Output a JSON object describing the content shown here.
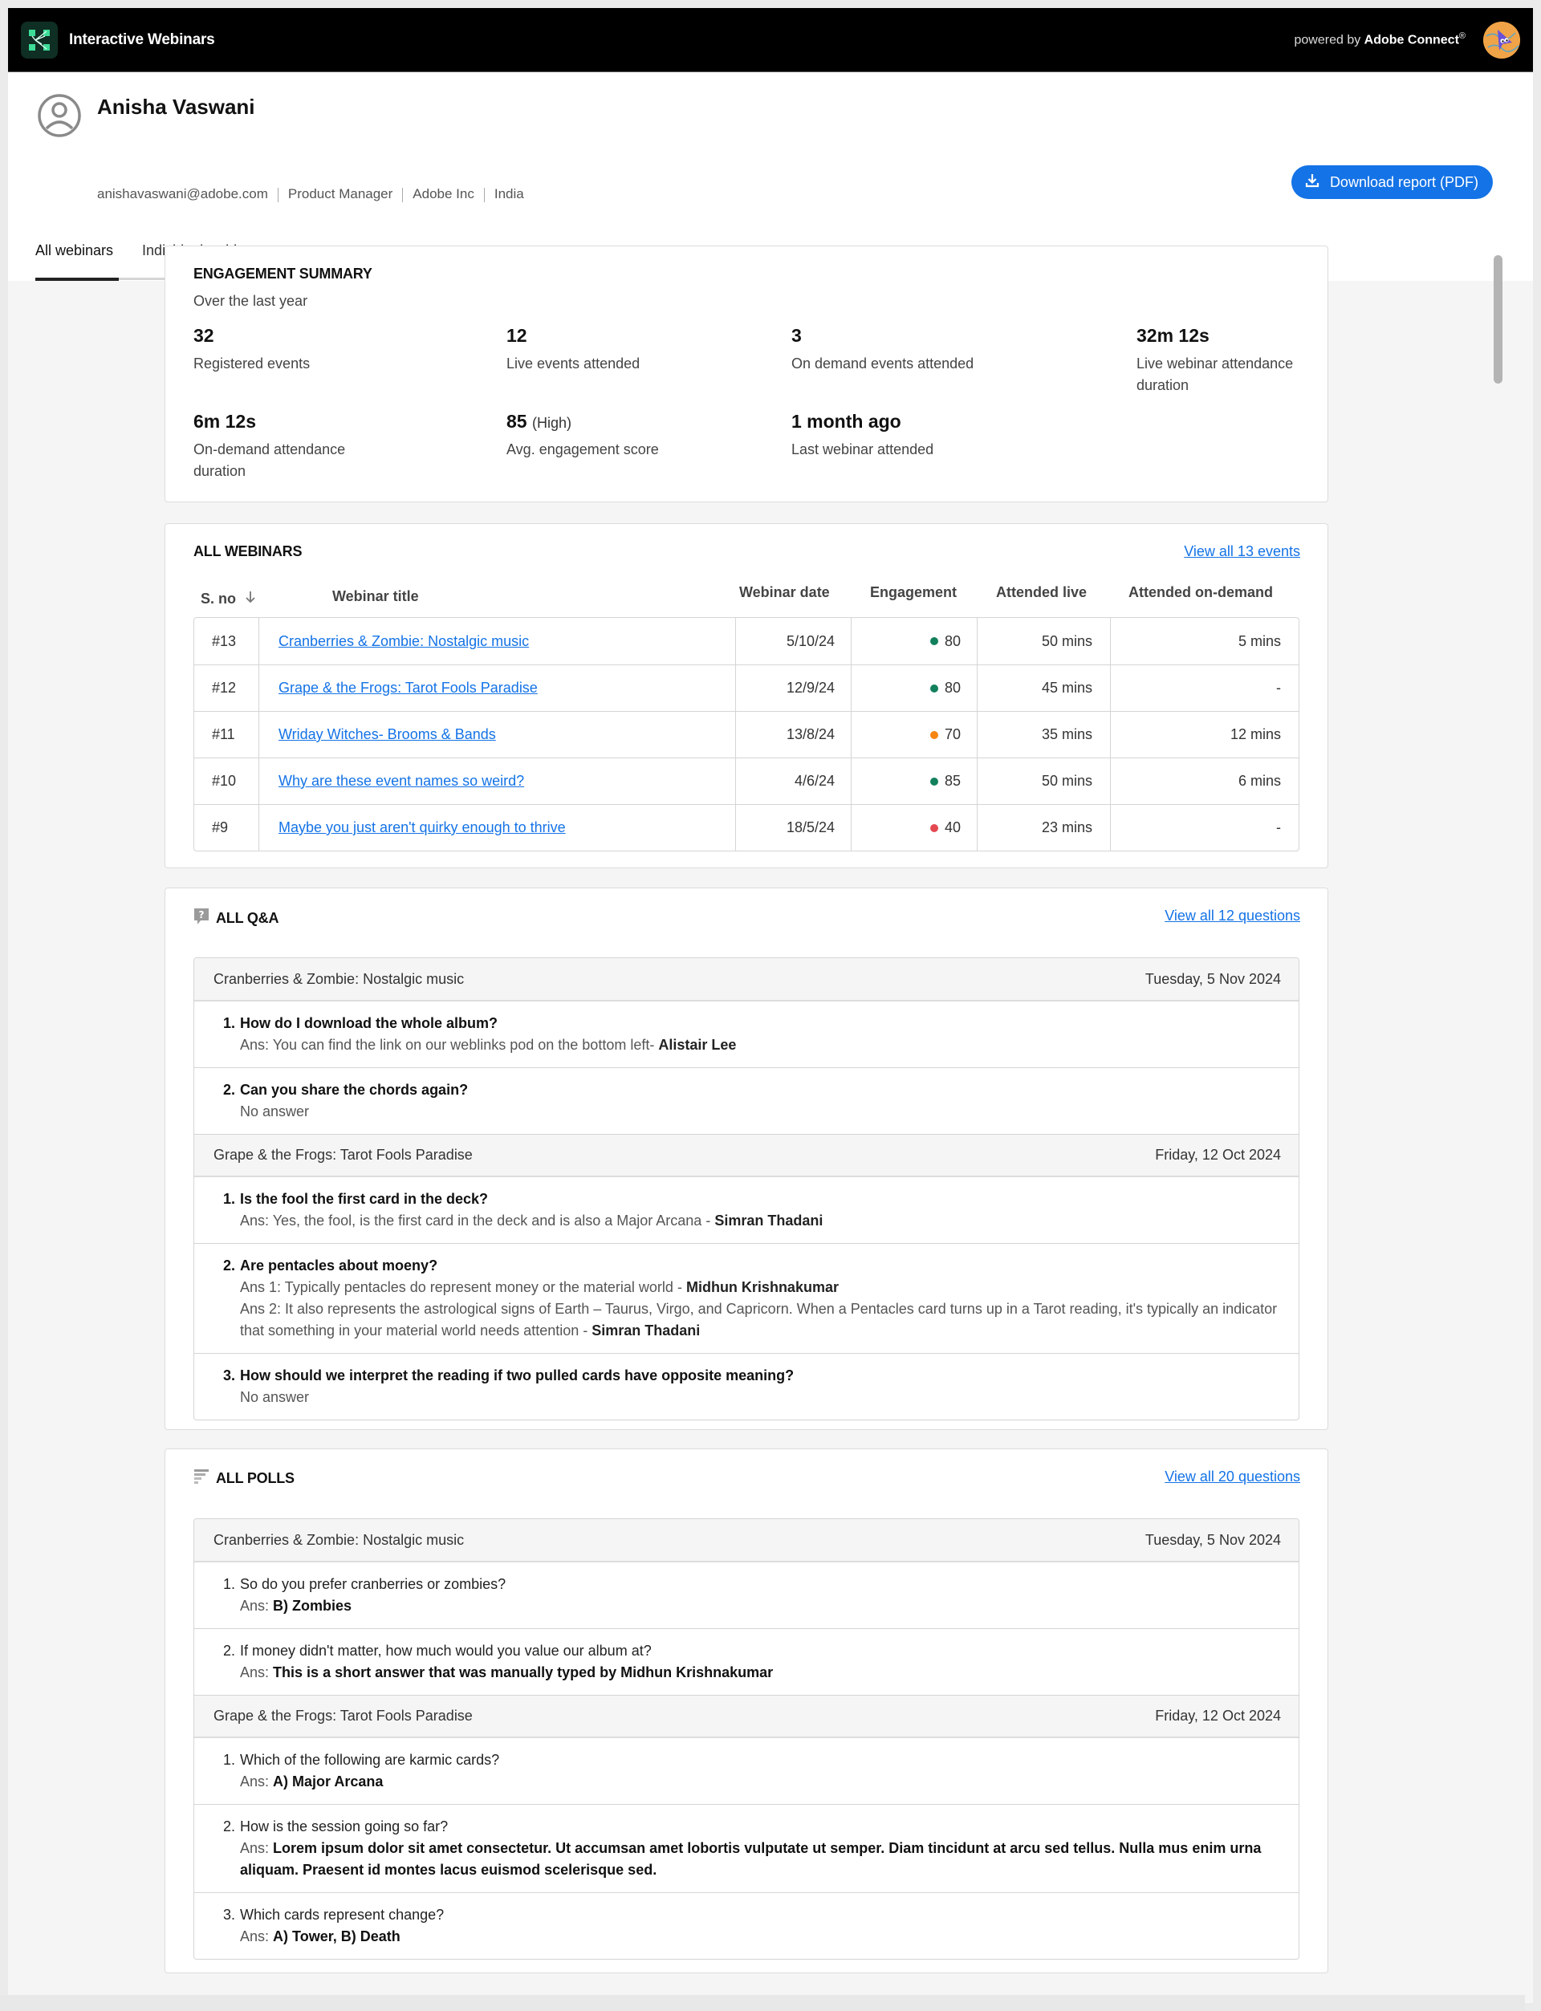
{
  "topbar": {
    "app_title": "Interactive Webinars",
    "powered_prefix": "powered by",
    "powered_brand": "Adobe Connect",
    "powered_mark": "®"
  },
  "profile": {
    "name": "Anisha Vaswani",
    "email": "anishavaswani@adobe.com",
    "role": "Product Manager",
    "company": "Adobe Inc",
    "country": "India",
    "download_label": "Download report (PDF)"
  },
  "tabs": [
    {
      "label": "All webinars",
      "active": true
    },
    {
      "label": "Individual webinar",
      "active": false
    }
  ],
  "summary": {
    "title": "ENGAGEMENT SUMMARY",
    "subtitle": "Over the last year",
    "stats": [
      {
        "value": "32",
        "suffix": "",
        "label": "Registered events"
      },
      {
        "value": "12",
        "suffix": "",
        "label": "Live events attended"
      },
      {
        "value": "3",
        "suffix": "",
        "label": "On demand events attended"
      },
      {
        "value": "32m 12s",
        "suffix": "",
        "label": "Live webinar attendance duration"
      },
      {
        "value": "6m 12s",
        "suffix": "",
        "label": "On-demand attendance duration"
      },
      {
        "value": "85",
        "suffix": "(High)",
        "label": "Avg. engagement score"
      },
      {
        "value": "1 month ago",
        "suffix": "",
        "label": "Last webinar attended"
      }
    ]
  },
  "webinars": {
    "title": "ALL WEBINARS",
    "view_all": "View all 13 events",
    "columns": {
      "sno": "S. no",
      "title": "Webinar title",
      "date": "Webinar date",
      "engagement": "Engagement",
      "live": "Attended live",
      "on_demand": "Attended on-demand"
    },
    "rows": [
      {
        "sno": "#13",
        "title": "Cranberries & Zombie: Nostalgic music",
        "date": "5/10/24",
        "engagement": "80",
        "eng_color": "#12805c",
        "live": "50 mins",
        "on_demand": "5 mins"
      },
      {
        "sno": "#12",
        "title": "Grape & the Frogs: Tarot Fools Paradise",
        "date": "12/9/24",
        "engagement": "80",
        "eng_color": "#12805c",
        "live": "45 mins",
        "on_demand": "-"
      },
      {
        "sno": "#11",
        "title": "Wriday Witches- Brooms & Bands",
        "date": "13/8/24",
        "engagement": "70",
        "eng_color": "#f68511",
        "live": "35 mins",
        "on_demand": "12 mins"
      },
      {
        "sno": "#10",
        "title": "Why are these event names so weird?",
        "date": "4/6/24",
        "engagement": "85",
        "eng_color": "#12805c",
        "live": "50 mins",
        "on_demand": "6 mins"
      },
      {
        "sno": "#9",
        "title": "Maybe you just aren't quirky enough to thrive",
        "date": "18/5/24",
        "engagement": "40",
        "eng_color": "#e34850",
        "live": "23 mins",
        "on_demand": "-"
      }
    ]
  },
  "qa": {
    "title": "ALL Q&A",
    "view_all": "View all 12 questions",
    "groups": [
      {
        "webinar": "Cranberries & Zombie: Nostalgic music",
        "date": "Tuesday, 5 Nov 2024",
        "items": [
          {
            "num": "1.",
            "question": "How do I download the whole album?",
            "answers": [
              {
                "prefix": "Ans: You can find the link on our weblinks pod on the bottom left-",
                "author": "Alistair Lee"
              }
            ]
          },
          {
            "num": "2.",
            "question": "Can you share the chords again?",
            "answers": [
              {
                "prefix": "No answer",
                "author": ""
              }
            ]
          }
        ]
      },
      {
        "webinar": "Grape & the Frogs: Tarot Fools Paradise",
        "date": "Friday, 12 Oct 2024",
        "items": [
          {
            "num": "1.",
            "question": "Is the fool the first card in the deck?",
            "answers": [
              {
                "prefix": "Ans: Yes, the fool, is the first card in the deck and is also a Major Arcana -",
                "author": "Simran Thadani"
              }
            ]
          },
          {
            "num": "2.",
            "question": "Are pentacles about moeny?",
            "answers": [
              {
                "prefix": "Ans 1: Typically pentacles do represent money or the material world -",
                "author": "Midhun Krishnakumar"
              },
              {
                "prefix": "Ans 2: It also represents the astrological signs of Earth – Taurus, Virgo, and Capricorn. When a Pentacles card turns up in a Tarot reading, it's typically an indicator that something in your material world needs attention -",
                "author": "Simran Thadani"
              }
            ]
          },
          {
            "num": "3.",
            "question": "How should we interpret the reading if two pulled cards have opposite meaning?",
            "answers": [
              {
                "prefix": "No answer",
                "author": ""
              }
            ]
          }
        ]
      }
    ]
  },
  "polls": {
    "title": "ALL POLLS",
    "view_all": "View all 20 questions",
    "groups": [
      {
        "webinar": "Cranberries & Zombie: Nostalgic music",
        "date": "Tuesday, 5 Nov 2024",
        "items": [
          {
            "num": "1.",
            "question": "So do you prefer cranberries or zombies?",
            "ans_prefix": "Ans:",
            "answer": "B) Zombies"
          },
          {
            "num": "2.",
            "question": "If money didn't matter, how much would you value our album at?",
            "ans_prefix": "Ans:",
            "answer": "This is a short answer that was manually typed by Midhun Krishnakumar"
          }
        ]
      },
      {
        "webinar": "Grape & the Frogs: Tarot Fools Paradise",
        "date": "Friday, 12 Oct 2024",
        "items": [
          {
            "num": "1.",
            "question": "Which of the following are karmic cards?",
            "ans_prefix": "Ans:",
            "answer": "A) Major Arcana"
          },
          {
            "num": "2.",
            "question": "How is the session going so far?",
            "ans_prefix": "Ans:",
            "answer": "Lorem ipsum dolor sit amet consectetur. Ut accumsan amet lobortis vulputate ut semper. Diam tincidunt at arcu sed tellus. Nulla mus enim urna aliquam. Praesent id montes lacus euismod scelerisque sed."
          },
          {
            "num": "3.",
            "question": "Which cards represent change?",
            "ans_prefix": "Ans:",
            "answer": "A) Tower, B) Death"
          }
        ]
      }
    ]
  },
  "colors": {
    "accent": "#1473e6",
    "topbar": "#000000",
    "engagement_high": "#12805c",
    "engagement_mid": "#f68511",
    "engagement_low": "#e34850"
  }
}
